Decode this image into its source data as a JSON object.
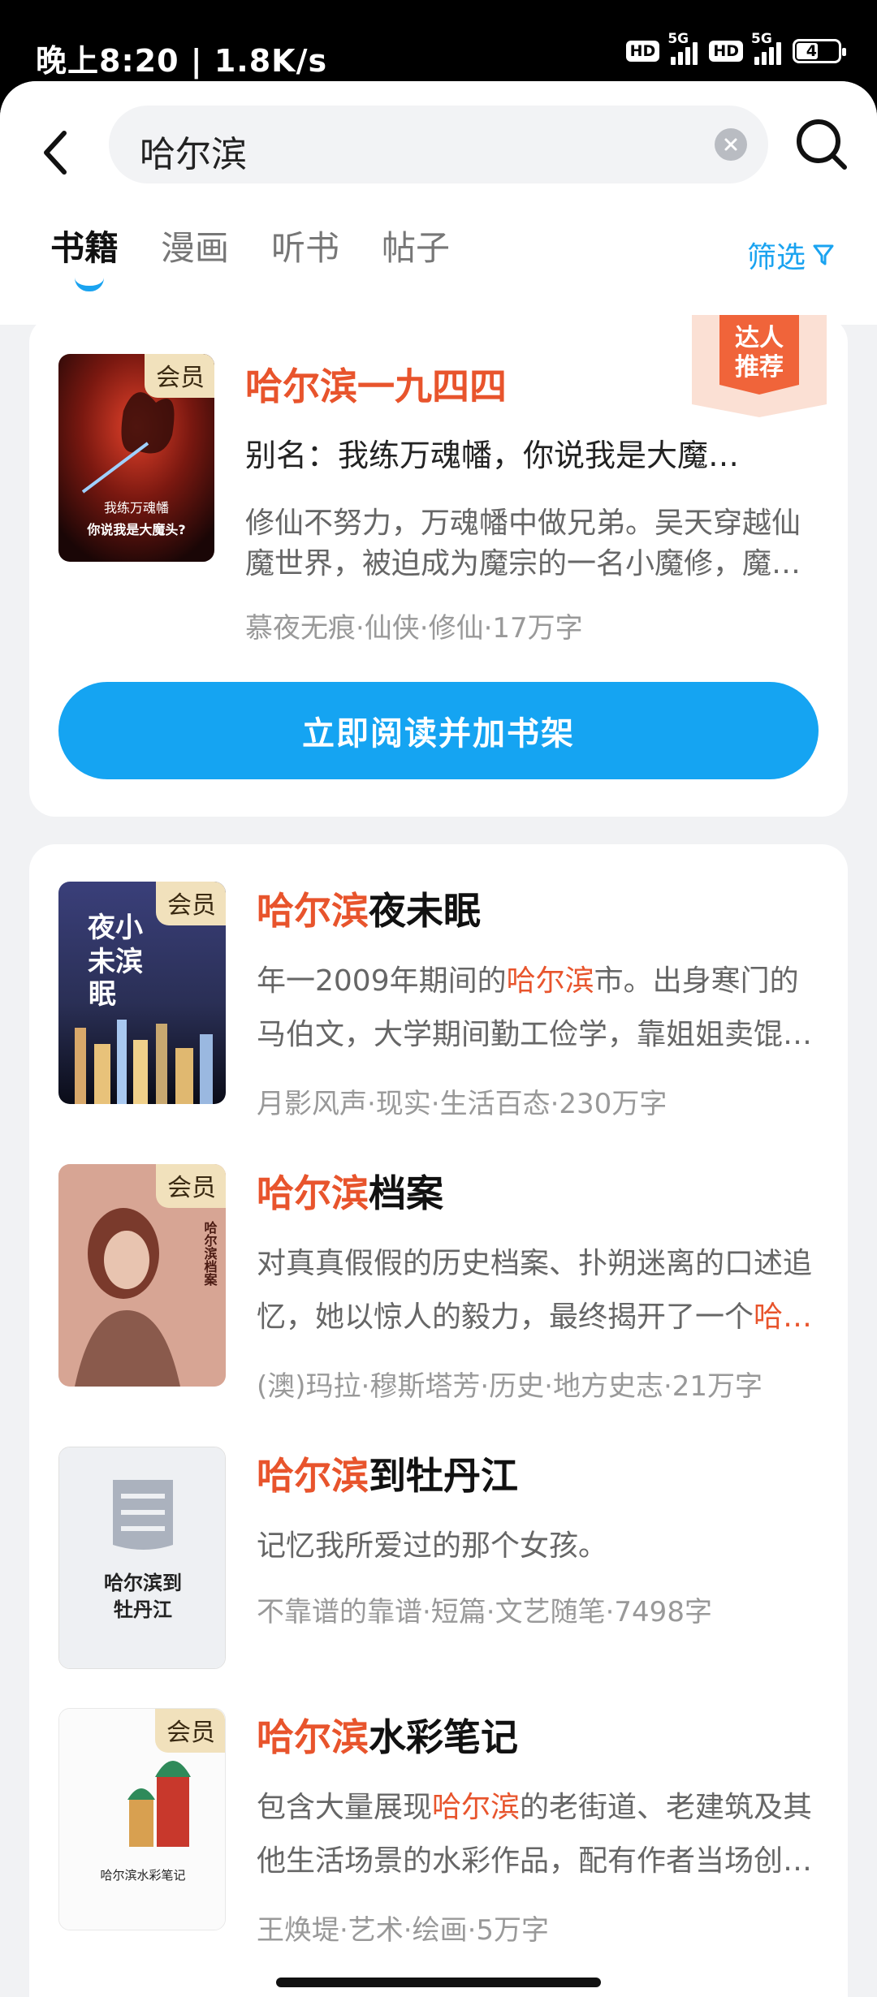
{
  "status": {
    "time": "晚上8:20 | 1.8K/s",
    "hd": "HD",
    "net": "5G",
    "battery": "49",
    "battery_level": 0.49
  },
  "search": {
    "query": "哈尔滨"
  },
  "tabs": [
    {
      "label": "书籍",
      "active": true
    },
    {
      "label": "漫画",
      "active": false
    },
    {
      "label": "听书",
      "active": false
    },
    {
      "label": "帖子",
      "active": false
    }
  ],
  "filter_label": "筛选",
  "accent": "#15a4f2",
  "highlight": "#e8542c",
  "featured": {
    "badge": [
      "达人",
      "推荐"
    ],
    "member_tag": "会员",
    "title": "哈尔滨一九四四",
    "alias": "别名：我练万魂幡，你说我是大魔…",
    "desc_lines": [
      "修仙不努力，万魂幡中做兄弟。吴天穿越仙",
      "魔世界，被迫成为魔宗的一名小魔修，魔…"
    ],
    "meta": "慕夜无痕·仙侠·修仙·17万字",
    "cover_text": [
      "我练万魂幡",
      "你说我是大魔头?"
    ],
    "button": "立即阅读并加书架"
  },
  "results": [
    {
      "member_tag": "会员",
      "title_hl": "哈尔滨",
      "title_rest": "夜未眠",
      "desc_lines": [
        {
          "pre": "年一2009年期间的",
          "hl": "哈尔滨",
          "post": "市。出身寒门的"
        },
        {
          "pre": "马伯文，大学期间勤工俭学，靠姐姐卖馄…",
          "hl": "",
          "post": ""
        }
      ],
      "meta": "月影风声·现实·生活百态·230万字",
      "cover_text": [
        "夜小",
        "未滨",
        "眠"
      ]
    },
    {
      "member_tag": "会员",
      "title_hl": "哈尔滨",
      "title_rest": "档案",
      "desc_lines": [
        {
          "pre": "对真真假假的历史档案、扑朔迷离的口述追",
          "hl": "",
          "post": ""
        },
        {
          "pre": "忆，她以惊人的毅力，最终揭开了一个",
          "hl": "哈…",
          "post": ""
        }
      ],
      "meta": "(澳)玛拉·穆斯塔芳·历史·地方史志·21万字",
      "cover_text": [
        "哈尔滨档案"
      ]
    },
    {
      "member_tag": "",
      "title_hl": "哈尔滨",
      "title_rest": "到牡丹江",
      "desc_lines": [
        {
          "pre": "记忆我所爱过的那个女孩。",
          "hl": "",
          "post": ""
        }
      ],
      "meta": "不靠谱的靠谱·短篇·文艺随笔·7498字",
      "cover_text": [
        "哈尔滨到",
        "牡丹江"
      ]
    },
    {
      "member_tag": "会员",
      "title_hl": "哈尔滨",
      "title_rest": "水彩笔记",
      "desc_lines": [
        {
          "pre": "包含大量展现",
          "hl": "哈尔滨",
          "post": "的老街道、老建筑及其"
        },
        {
          "pre": "他生活场景的水彩作品，配有作者当场创…",
          "hl": "",
          "post": ""
        }
      ],
      "meta": "王焕堤·艺术·绘画·5万字",
      "cover_text": [
        "哈尔滨水彩笔记"
      ]
    }
  ]
}
